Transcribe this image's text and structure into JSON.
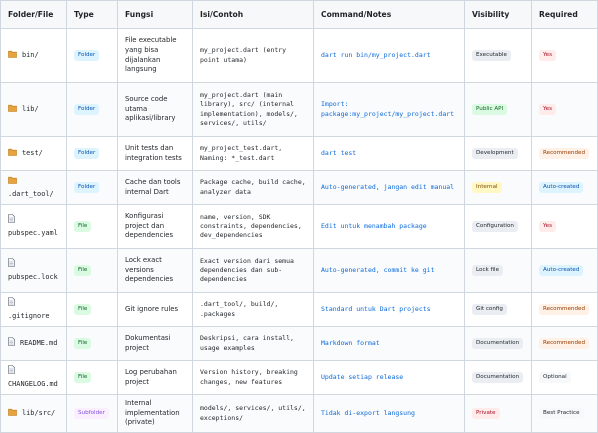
{
  "table": {
    "headers": [
      "Folder/File",
      "Type",
      "Fungsi",
      "Isi/Contoh",
      "Command/Notes",
      "Visibility",
      "Required"
    ],
    "rows": [
      {
        "name": "bin/",
        "icon": "folder-icon",
        "type": "Folder",
        "fungsi": "File executable yang bisa dijalankan langsung",
        "isi": "my_project.dart (entry point utama)",
        "cmd": "dart run bin/my_project.dart",
        "visibility": "Executable",
        "required": "Yes"
      },
      {
        "name": "lib/",
        "icon": "folder-icon",
        "type": "Folder",
        "fungsi": "Source code utama aplikasi/library",
        "isi": "my_project.dart (main library), src/ (internal implementation), models/, services/, utils/",
        "cmd": "Import: package:my_project/my_project.dart",
        "visibility": "Public API",
        "required": "Yes"
      },
      {
        "name": "test/",
        "icon": "folder-icon",
        "type": "Folder",
        "fungsi": "Unit tests dan integration tests",
        "isi": "my_project_test.dart, Naming: *_test.dart",
        "cmd": "dart test",
        "visibility": "Development",
        "required": "Recommended"
      },
      {
        "name": ".dart_tool/",
        "icon": "folder-icon",
        "type": "Folder",
        "fungsi": "Cache dan tools internal Dart",
        "isi": "Package cache, build cache, analyzer data",
        "cmd": "Auto-generated, jangan edit manual",
        "visibility": "Internal",
        "required": "Auto-created"
      },
      {
        "name": "pubspec.yaml",
        "icon": "file-icon",
        "type": "File",
        "fungsi": "Konfigurasi project dan dependencies",
        "isi": "name, version, SDK constraints, dependencies, dev_dependencies",
        "cmd": "Edit untuk menambah package",
        "visibility": "Configuration",
        "required": "Yes"
      },
      {
        "name": "pubspec.lock",
        "icon": "file-icon",
        "type": "File",
        "fungsi": "Lock exact versions dependencies",
        "isi": "Exact version dari semua dependencies dan sub-dependencies",
        "cmd": "Auto-generated, commit ke git",
        "visibility": "Lock file",
        "required": "Auto-created"
      },
      {
        "name": ".gitignore",
        "icon": "file-icon",
        "type": "File",
        "fungsi": "Git ignore rules",
        "isi": ".dart_tool/, build/, .packages",
        "cmd": "Standard untuk Dart projects",
        "visibility": "Git config",
        "required": "Recommended"
      },
      {
        "name": "README.md",
        "icon": "file-icon",
        "type": "File",
        "fungsi": "Dokumentasi project",
        "isi": "Deskripsi, cara install, usage examples",
        "cmd": "Markdown format",
        "visibility": "Documentation",
        "required": "Recommended"
      },
      {
        "name": "CHANGELOG.md",
        "icon": "file-icon",
        "type": "File",
        "fungsi": "Log perubahan project",
        "isi": "Version history, breaking changes, new features",
        "cmd": "Update setiap release",
        "visibility": "Documentation",
        "required": "Optional"
      },
      {
        "name": "lib/src/",
        "icon": "folder-icon",
        "type": "Subfolder",
        "fungsi": "Internal implementation (private)",
        "isi": "models/, services/, utils/, exceptions/",
        "cmd": "Tidak di-export langsung",
        "visibility": "Private",
        "required": "Best Practice"
      }
    ]
  }
}
